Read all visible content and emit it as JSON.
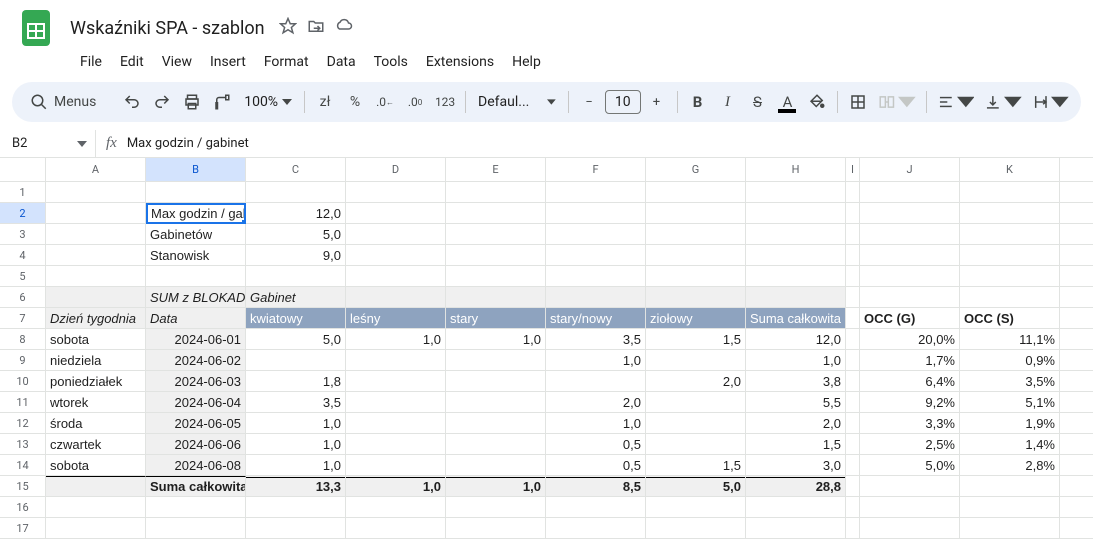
{
  "doc": {
    "title": "Wskaźniki SPA - szablon"
  },
  "menubar": {
    "file": "File",
    "edit": "Edit",
    "view": "View",
    "insert": "Insert",
    "format": "Format",
    "data": "Data",
    "tools": "Tools",
    "extensions": "Extensions",
    "help": "Help"
  },
  "toolbar": {
    "menus": "Menus",
    "zoom": "100%",
    "currency": "zł",
    "percent": "%",
    "n123": "123",
    "font": "Defaul...",
    "font_size": "10"
  },
  "namebox": "B2",
  "formula": "Max godzin / gabinet",
  "cols": [
    "A",
    "B",
    "C",
    "D",
    "E",
    "F",
    "G",
    "H",
    "I",
    "J",
    "K"
  ],
  "rows_labels": [
    "1",
    "2",
    "3",
    "4",
    "5",
    "6",
    "7",
    "8",
    "9",
    "10",
    "11",
    "12",
    "13",
    "14",
    "15",
    "16",
    "17"
  ],
  "c": {
    "B2": "Max godzin / gab",
    "C2": "12,0",
    "B3": "Gabinetów",
    "C3": "5,0",
    "B4": "Stanowisk",
    "C4": "9,0",
    "B6": "SUM z BLOKAD",
    "C6": "Gabinet",
    "A7": "Dzień tygodnia",
    "B7": "Data",
    "C7": "kwiatowy",
    "D7": "leśny",
    "E7": "stary",
    "F7": "stary/nowy",
    "G7": "ziołowy",
    "H7": "Suma całkowita",
    "J7": "OCC (G)",
    "K7": "OCC (S)",
    "A8": "sobota",
    "B8": "2024-06-01",
    "C8": "5,0",
    "D8": "1,0",
    "E8": "1,0",
    "F8": "3,5",
    "G8": "1,5",
    "H8": "12,0",
    "J8": "20,0%",
    "K8": "11,1%",
    "A9": "niedziela",
    "B9": "2024-06-02",
    "F9": "1,0",
    "H9": "1,0",
    "J9": "1,7%",
    "K9": "0,9%",
    "A10": "poniedziałek",
    "B10": "2024-06-03",
    "C10": "1,8",
    "G10": "2,0",
    "H10": "3,8",
    "J10": "6,4%",
    "K10": "3,5%",
    "A11": "wtorek",
    "B11": "2024-06-04",
    "C11": "3,5",
    "F11": "2,0",
    "H11": "5,5",
    "J11": "9,2%",
    "K11": "5,1%",
    "A12": "środa",
    "B12": "2024-06-05",
    "C12": "1,0",
    "F12": "1,0",
    "H12": "2,0",
    "J12": "3,3%",
    "K12": "1,9%",
    "A13": "czwartek",
    "B13": "2024-06-06",
    "C13": "1,0",
    "F13": "0,5",
    "H13": "1,5",
    "J13": "2,5%",
    "K13": "1,4%",
    "A14": "sobota",
    "B14": "2024-06-08",
    "C14": "1,0",
    "F14": "0,5",
    "G14": "1,5",
    "H14": "3,0",
    "J14": "5,0%",
    "K14": "2,8%",
    "B15": "Suma całkowita",
    "C15": "13,3",
    "D15": "1,0",
    "E15": "1,0",
    "F15": "8,5",
    "G15": "5,0",
    "H15": "28,8"
  }
}
